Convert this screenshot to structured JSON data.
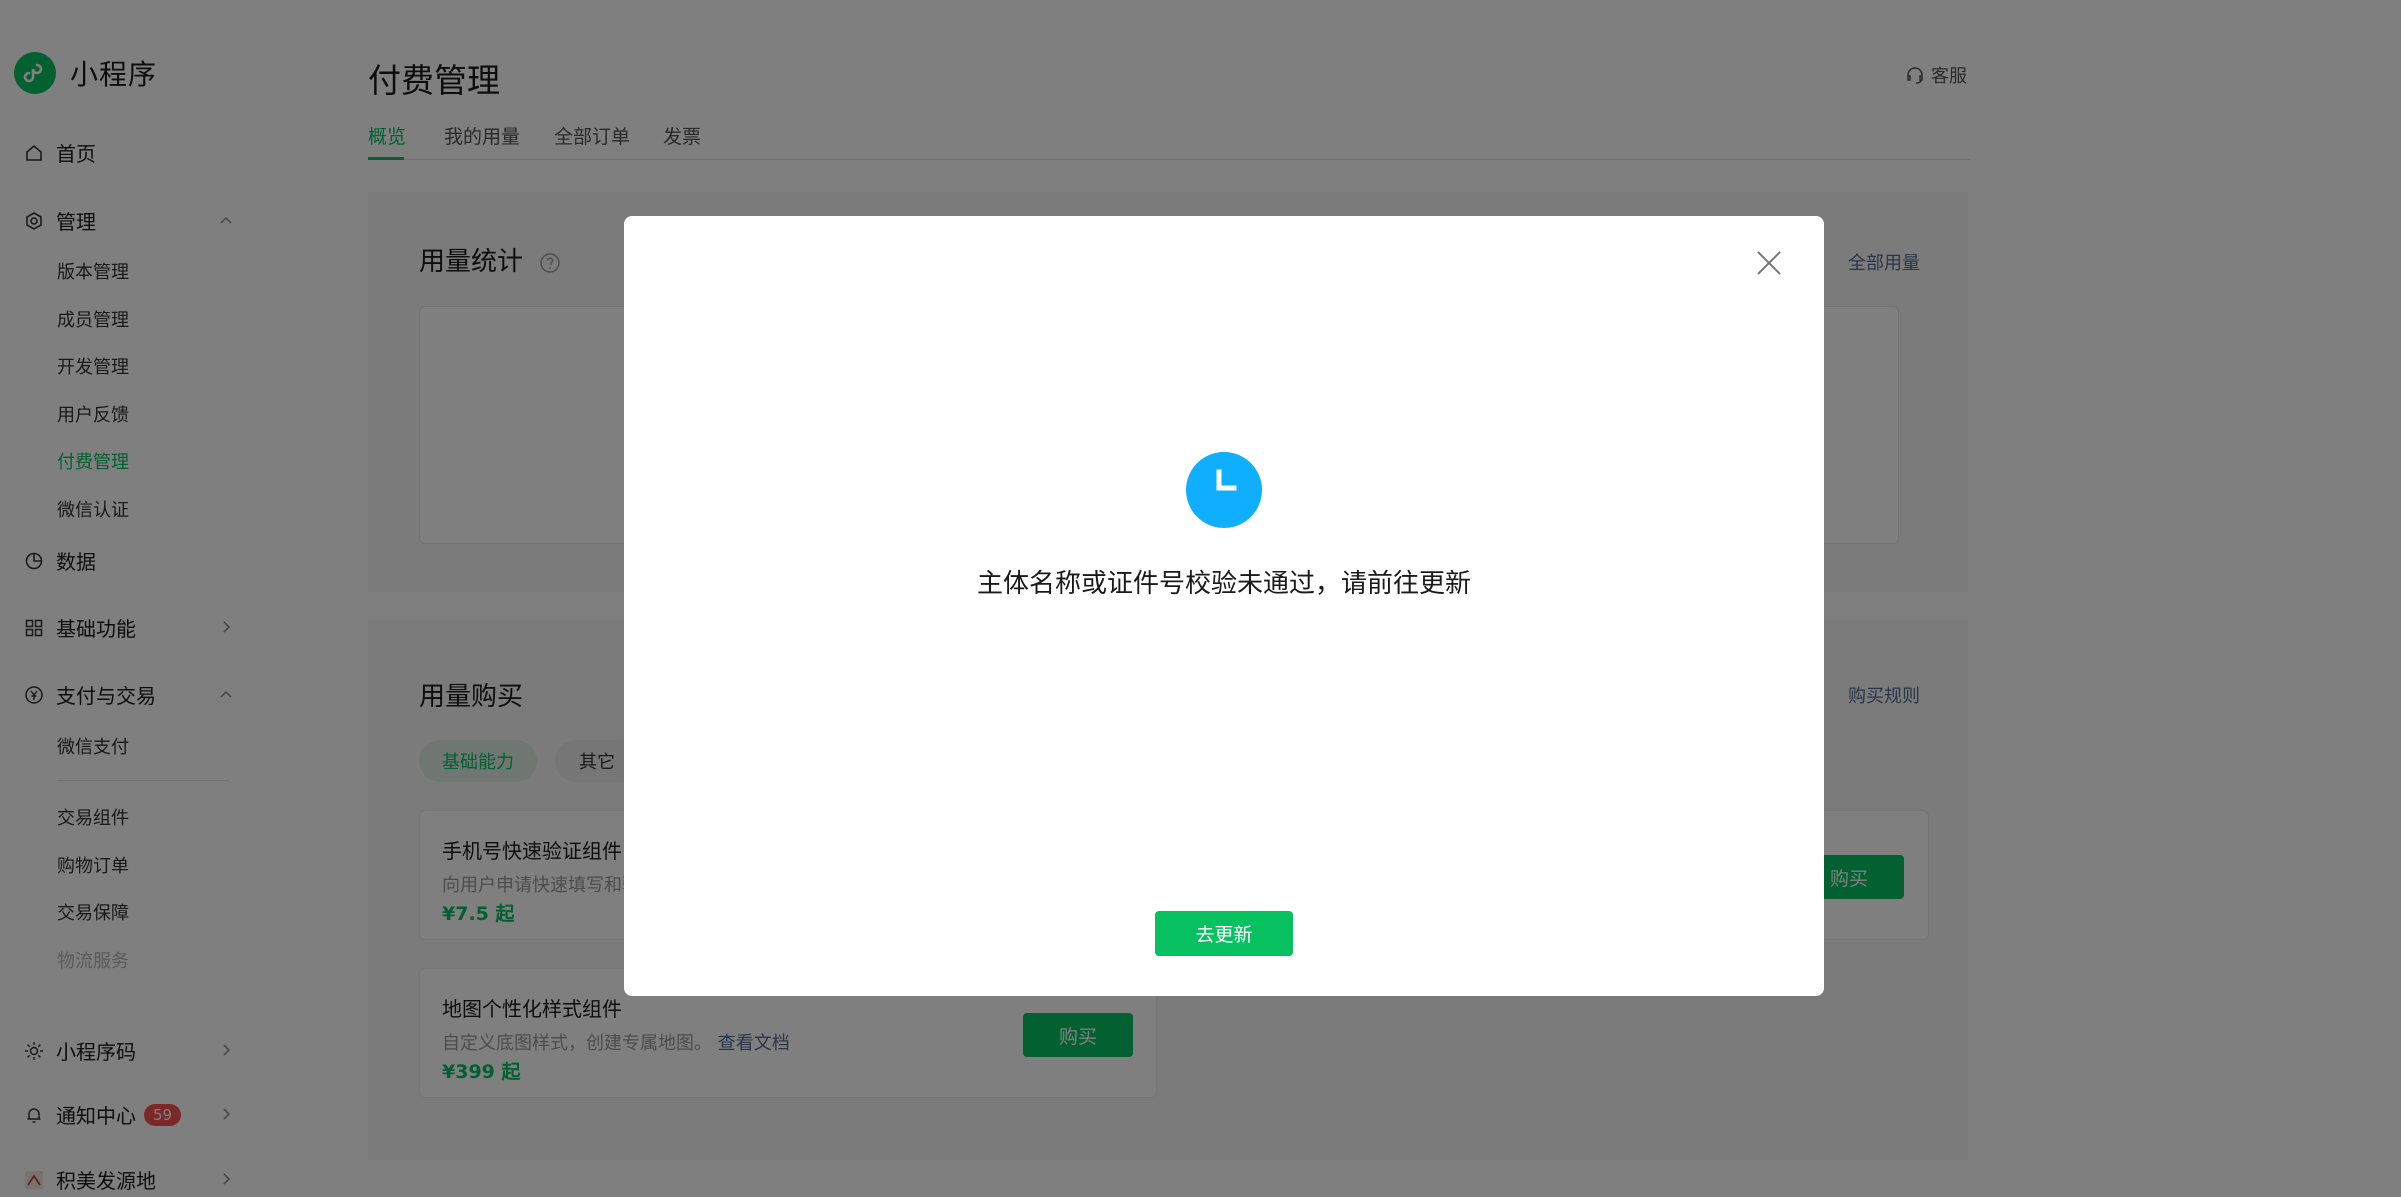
{
  "app": {
    "logo_text": "小程序",
    "brand_color": "#07c160"
  },
  "sidebar": {
    "home": "首页",
    "manage": "管理",
    "manage_items": [
      "版本管理",
      "成员管理",
      "开发管理",
      "用户反馈",
      "付费管理",
      "微信认证"
    ],
    "active_item": "付费管理",
    "data": "数据",
    "basic": "基础功能",
    "pay": "支付与交易",
    "pay_items": [
      "微信支付",
      "交易组件",
      "购物订单",
      "交易保障",
      "物流服务"
    ],
    "qrcode": "小程序码",
    "notify": "通知中心",
    "notify_count": "59",
    "account": "积美发源地"
  },
  "header": {
    "title": "付费管理",
    "service": "客服",
    "tabs": [
      "概览",
      "我的用量",
      "全部订单",
      "发票"
    ],
    "active_tab": "概览"
  },
  "usage_stats": {
    "title": "用量统计",
    "link": "全部用量"
  },
  "purchase": {
    "title": "用量购买",
    "link": "购买规则",
    "chips": [
      "基础能力",
      "其它"
    ],
    "products": [
      {
        "name": "手机号快速验证组件",
        "desc": "向用户申请快速填写和验",
        "price": "¥7.5 起",
        "button": "购买"
      },
      {
        "name": "地图个性化样式组件",
        "desc": "自定义底图样式，创建专属地图。",
        "doc_link": "查看文档",
        "price": "¥399 起",
        "button": "购买"
      }
    ]
  },
  "dialog": {
    "message": "主体名称或证件号校验未通过，请前往更新",
    "button": "去更新",
    "icon": "clock-icon",
    "icon_color": "#10aeff"
  }
}
